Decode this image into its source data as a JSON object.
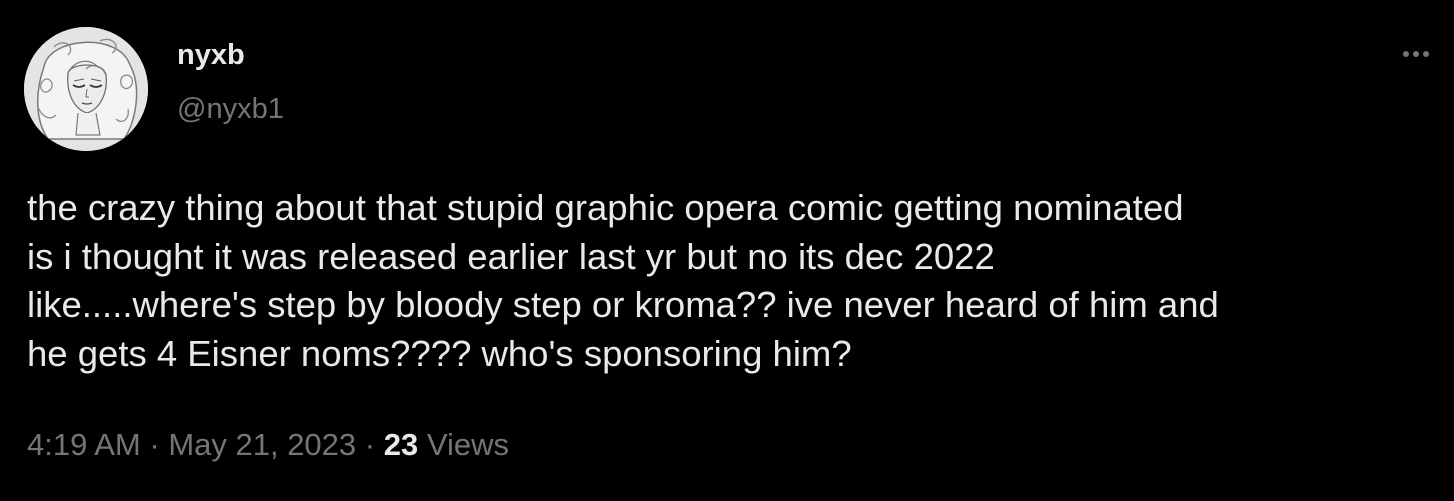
{
  "colors": {
    "background": "#000000",
    "primary_text": "#e7e9ea",
    "secondary_text": "#71767b"
  },
  "author": {
    "display_name": "nyxb",
    "handle": "@nyxb1",
    "avatar_icon": "avatar-illustration-icon"
  },
  "more_menu": {
    "icon": "more-horizontal-icon"
  },
  "tweet": {
    "text": "the crazy thing about that stupid graphic opera comic getting nominated\nis i thought it was released earlier last yr but no its dec 2022\nlike.....where's step by bloody step or kroma?? ive never heard of him and\nhe gets 4 Eisner noms???? who's sponsoring him?"
  },
  "meta": {
    "time": "4:19 AM",
    "separator": " · ",
    "date": "May 21, 2023",
    "views_count": "23",
    "views_label": " Views"
  }
}
